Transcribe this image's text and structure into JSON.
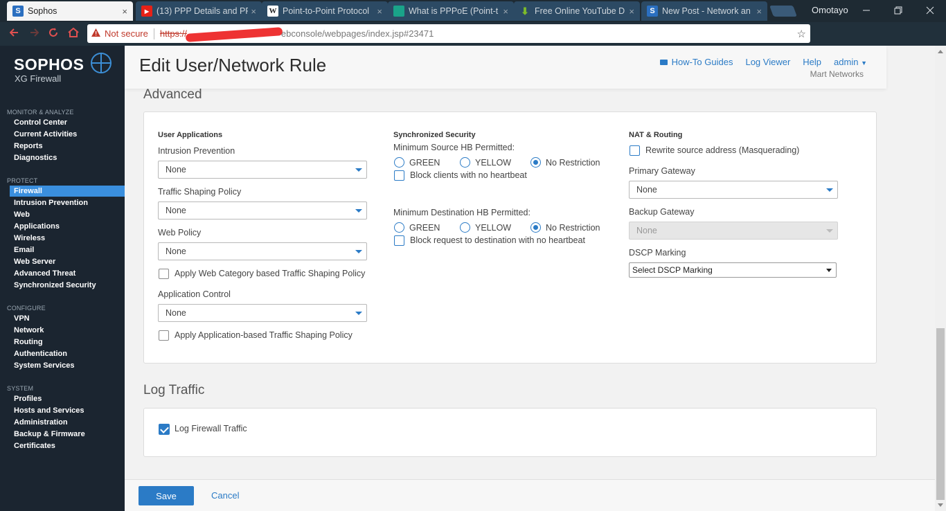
{
  "browser": {
    "tabs": [
      {
        "title": "Sophos",
        "favicon": "S",
        "favicon_color": "#2b6fc0"
      },
      {
        "title": "(13) PPP Details and PP",
        "favicon": "▶",
        "favicon_color": "#e62117"
      },
      {
        "title": "Point-to-Point Protocol",
        "favicon": "W",
        "favicon_color": "#ffffff"
      },
      {
        "title": "What is PPPoE (Point-t",
        "favicon": "",
        "favicon_color": "#1aa389"
      },
      {
        "title": "Free Online YouTube D",
        "favicon": "⬇",
        "favicon_color": "#7dbb2a"
      },
      {
        "title": "New Post - Network an",
        "favicon": "S",
        "favicon_color": "#2b6fc0"
      }
    ],
    "tab_close_glyph": "×",
    "profile_name": "Omotayo",
    "security_text": "Not secure",
    "url_scheme": "https://",
    "url_rest": "ebconsole/webpages/index.jsp#23471"
  },
  "sidebar": {
    "brand": "SOPHOS",
    "product": "XG Firewall",
    "sections": [
      {
        "label": "MONITOR & ANALYZE",
        "items": [
          "Control Center",
          "Current Activities",
          "Reports",
          "Diagnostics"
        ]
      },
      {
        "label": "PROTECT",
        "items": [
          "Firewall",
          "Intrusion Prevention",
          "Web",
          "Applications",
          "Wireless",
          "Email",
          "Web Server",
          "Advanced Threat",
          "Synchronized Security"
        ]
      },
      {
        "label": "CONFIGURE",
        "items": [
          "VPN",
          "Network",
          "Routing",
          "Authentication",
          "System Services"
        ]
      },
      {
        "label": "SYSTEM",
        "items": [
          "Profiles",
          "Hosts and Services",
          "Administration",
          "Backup & Firmware",
          "Certificates"
        ]
      }
    ],
    "active_item": "Firewall"
  },
  "header": {
    "title": "Edit User/Network Rule",
    "links": {
      "guides": "How-To Guides",
      "log_viewer": "Log Viewer",
      "help": "Help",
      "admin": "admin"
    },
    "org": "Mart Networks"
  },
  "advanced": {
    "title": "Advanced",
    "user_apps": {
      "title": "User Applications",
      "ips_label": "Intrusion Prevention",
      "ips_value": "None",
      "traffic_label": "Traffic Shaping Policy",
      "traffic_value": "None",
      "web_label": "Web Policy",
      "web_value": "None",
      "web_cat_shaping": "Apply Web Category based Traffic Shaping Policy",
      "app_control_label": "Application Control",
      "app_control_value": "None",
      "app_shaping": "Apply Application-based Traffic Shaping Policy"
    },
    "sync_security": {
      "title": "Synchronized Security",
      "min_source_label": "Minimum Source HB Permitted:",
      "options": [
        "GREEN",
        "YELLOW",
        "No Restriction"
      ],
      "source_selected": "No Restriction",
      "block_clients": "Block clients with no heartbeat",
      "min_dest_label": "Minimum Destination HB Permitted:",
      "dest_selected": "No Restriction",
      "block_dest": "Block request to destination with no heartbeat"
    },
    "nat": {
      "title": "NAT & Routing",
      "masquerade": "Rewrite source address (Masquerading)",
      "primary_gw_label": "Primary Gateway",
      "primary_gw_value": "None",
      "backup_gw_label": "Backup Gateway",
      "backup_gw_value": "None",
      "dscp_label": "DSCP Marking",
      "dscp_value": "Select DSCP Marking"
    }
  },
  "log_traffic": {
    "title": "Log Traffic",
    "log_firewall": "Log Firewall Traffic",
    "log_firewall_checked": true
  },
  "footer": {
    "save": "Save",
    "cancel": "Cancel"
  },
  "colors": {
    "accent": "#2b7bc6",
    "sidebar_bg": "#1b2530",
    "active_nav": "#3a8fde"
  }
}
